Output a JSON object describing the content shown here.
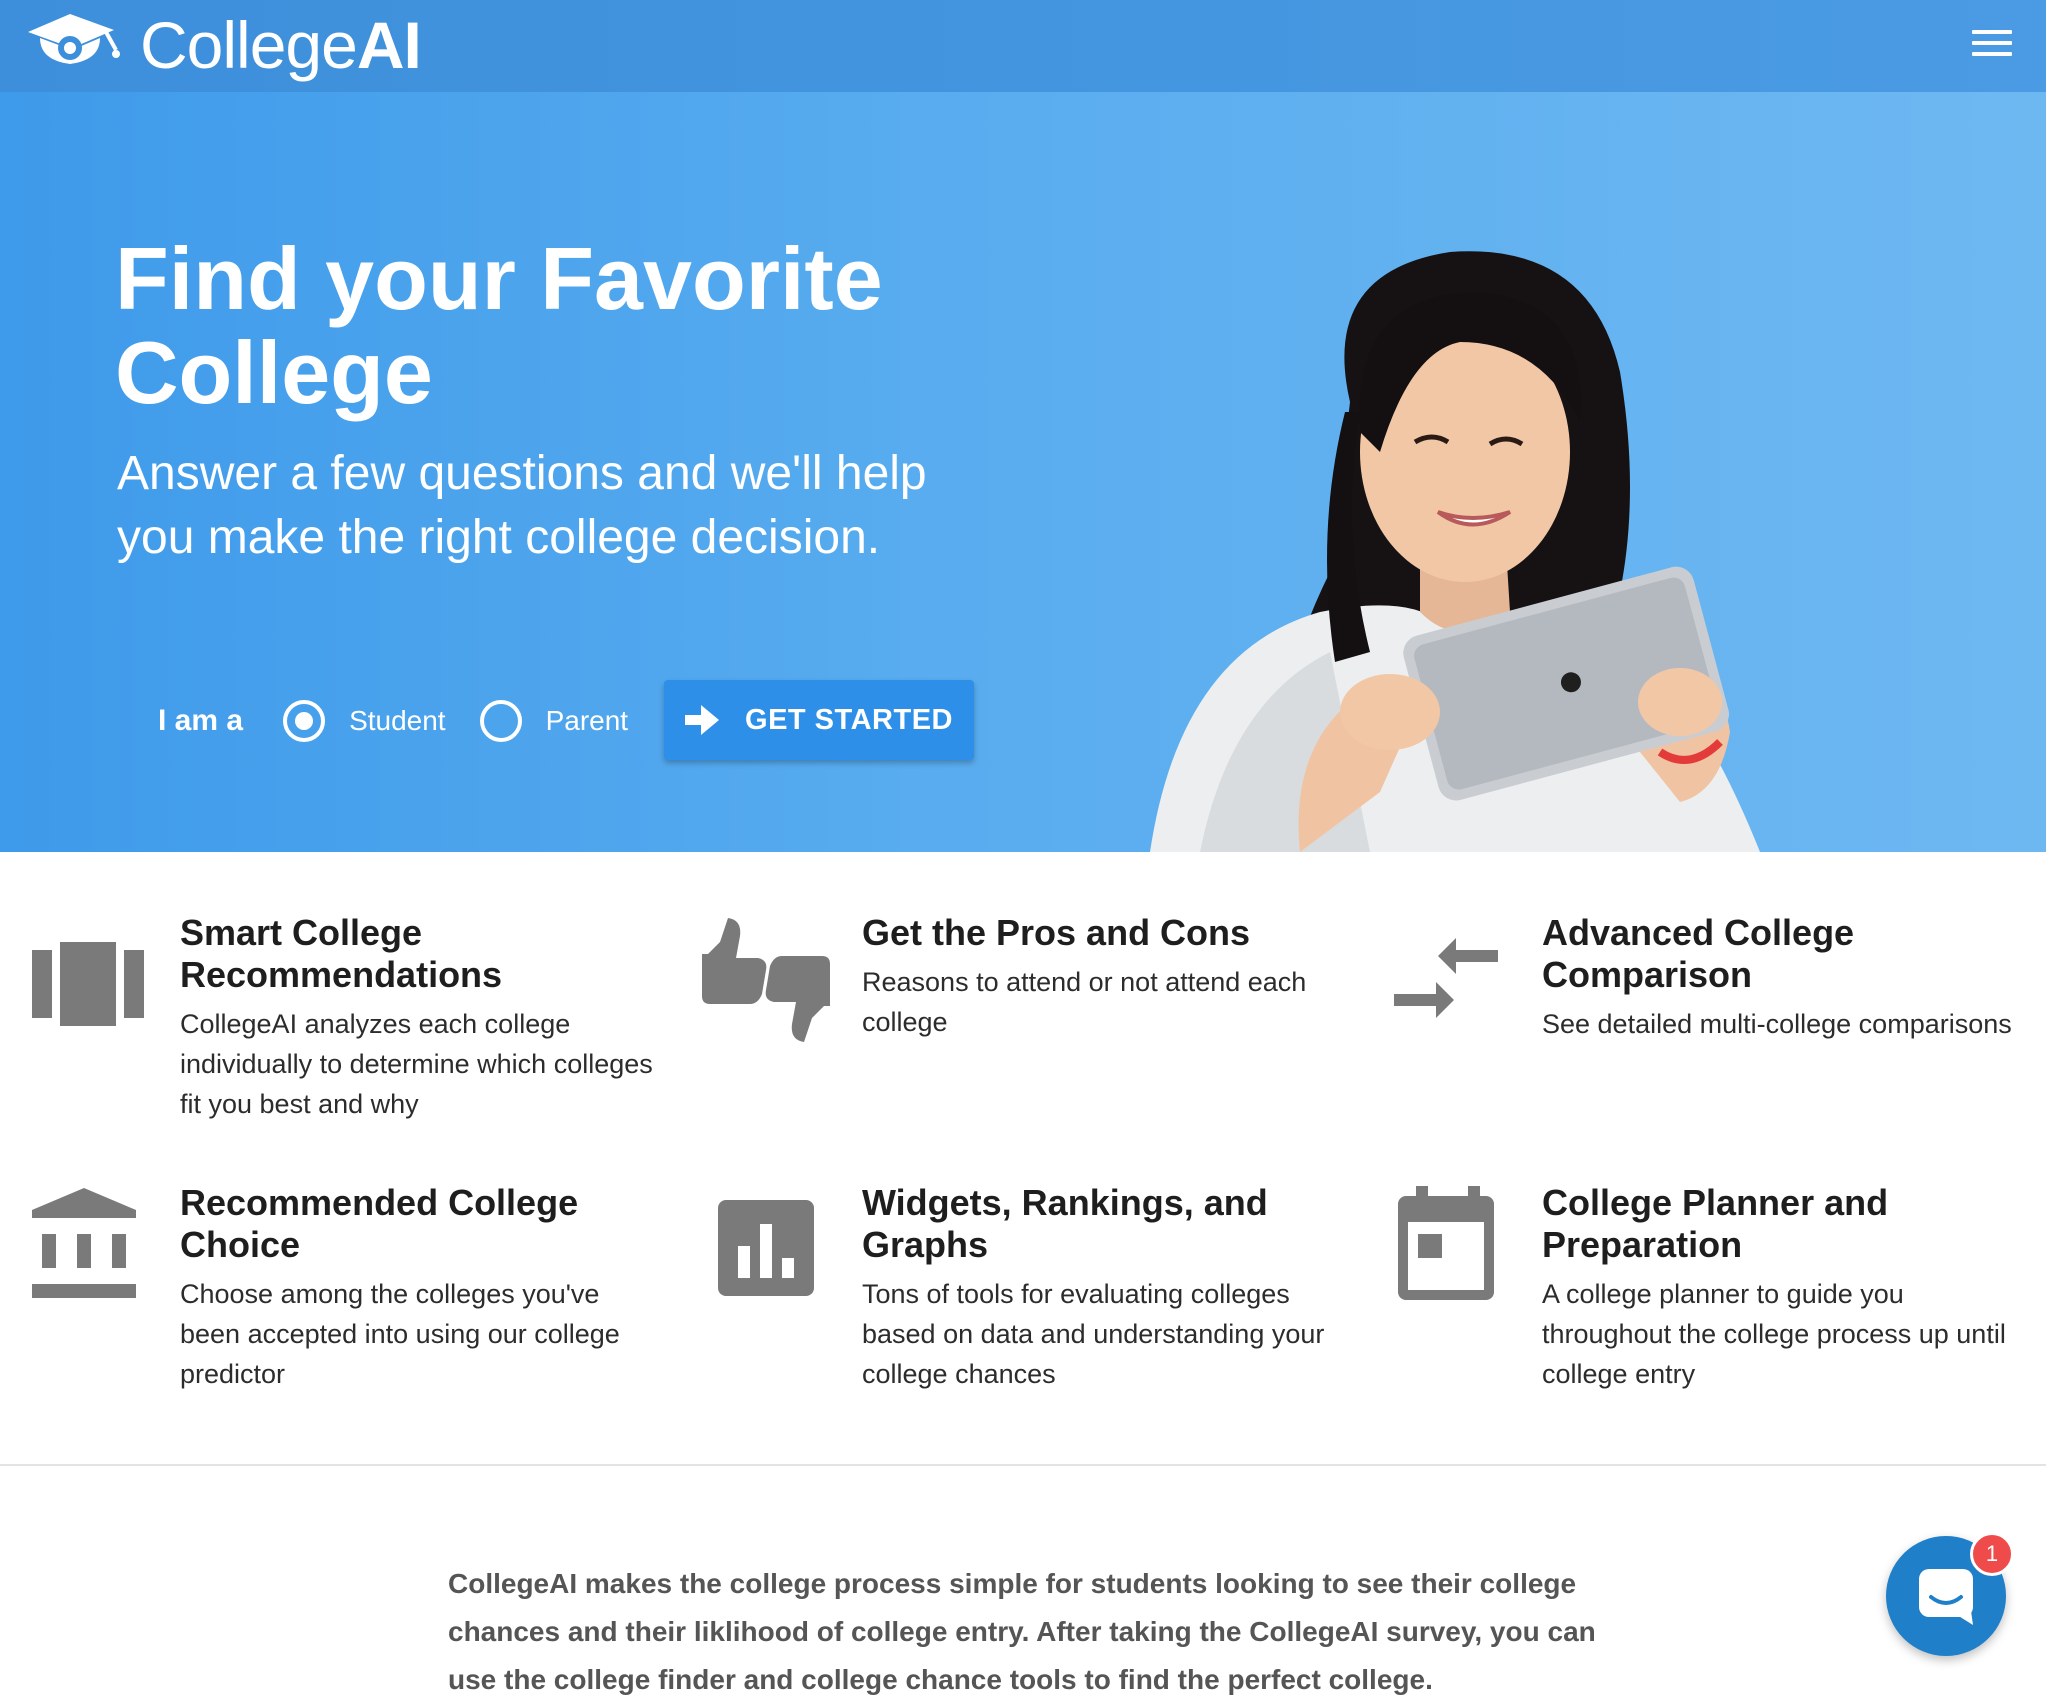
{
  "header": {
    "logo_text_regular": "College",
    "logo_text_bold": "AI",
    "menu_icon": "hamburger-menu-icon"
  },
  "hero": {
    "title": "Find your Favorite College",
    "subtitle": "Answer a few questions and we'll help you make the right college decision.",
    "role_label": "I am a",
    "role_options": [
      {
        "label": "Student",
        "selected": true
      },
      {
        "label": "Parent",
        "selected": false
      }
    ],
    "cta_label": "GET STARTED",
    "cta_icon": "arrow-right-icon"
  },
  "features": [
    {
      "icon": "view-column-icon",
      "title": "Smart College Recommendations",
      "desc": "CollegeAI analyzes each college individually to determine which colleges fit you best and why"
    },
    {
      "icon": "thumbs-up-down-icon",
      "title": "Get the Pros and Cons",
      "desc": "Reasons to attend or not attend each college"
    },
    {
      "icon": "compare-arrows-icon",
      "title": "Advanced College Comparison",
      "desc": "See detailed multi-college comparisons"
    },
    {
      "icon": "institution-icon",
      "title": "Recommended College Choice",
      "desc": "Choose among the colleges you've been accepted into using our college predictor"
    },
    {
      "icon": "bar-chart-icon",
      "title": "Widgets, Rankings, and Graphs",
      "desc": "Tons of tools for evaluating colleges based on data and understanding your college chances"
    },
    {
      "icon": "calendar-icon",
      "title": "College Planner and Preparation",
      "desc": "A college planner to guide you throughout the college process up until college entry"
    }
  ],
  "about": {
    "text": "CollegeAI makes the college process simple for students looking to see their college chances and their liklihood of college entry. After taking the CollegeAI survey, you can use the college finder and college chance tools to find the perfect college."
  },
  "chat": {
    "icon": "chat-bubble-icon",
    "badge_count": "1"
  },
  "colors": {
    "header": "#3d8fdb",
    "hero": "#58acef",
    "cta": "#2e8fe8",
    "icon_gray": "#7a7a7a",
    "chat": "#1f7fc9",
    "badge": "#ef4b4b"
  }
}
